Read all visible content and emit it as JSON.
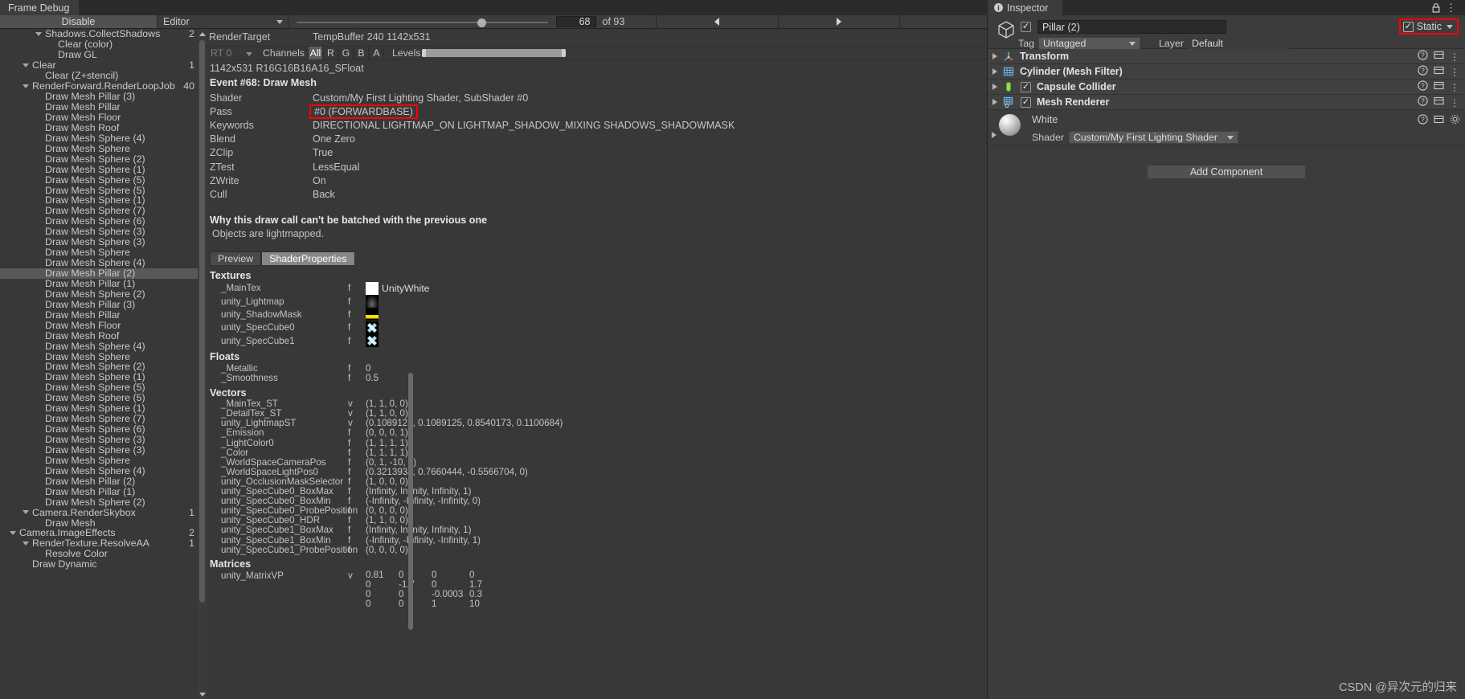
{
  "window": {
    "tab_title": "Frame Debug",
    "menu_icon": "⋮",
    "maximize_icon": "❐",
    "close_icon": "✕"
  },
  "toolbar": {
    "disable_label": "Disable",
    "context_value": "Editor",
    "event_index": "68",
    "event_total": "of 93",
    "prev_icon": "prev-triangle",
    "next_icon": "next-triangle"
  },
  "tree": {
    "items": [
      {
        "label": "Shadows.CollectShadows",
        "depth": 2,
        "arrow": true,
        "count": "2"
      },
      {
        "label": "Clear (color)",
        "depth": 3,
        "arrow": false,
        "count": ""
      },
      {
        "label": "Draw GL",
        "depth": 3,
        "arrow": false,
        "count": ""
      },
      {
        "label": "Clear",
        "depth": 1,
        "arrow": true,
        "count": "1"
      },
      {
        "label": "Clear (Z+stencil)",
        "depth": 2,
        "arrow": false,
        "count": ""
      },
      {
        "label": "RenderForward.RenderLoopJob",
        "depth": 1,
        "arrow": true,
        "count": "40"
      },
      {
        "label": "Draw Mesh Pillar (3)",
        "depth": 2,
        "arrow": false,
        "count": ""
      },
      {
        "label": "Draw Mesh Pillar",
        "depth": 2,
        "arrow": false,
        "count": ""
      },
      {
        "label": "Draw Mesh Floor",
        "depth": 2,
        "arrow": false,
        "count": ""
      },
      {
        "label": "Draw Mesh Roof",
        "depth": 2,
        "arrow": false,
        "count": ""
      },
      {
        "label": "Draw Mesh Sphere (4)",
        "depth": 2,
        "arrow": false,
        "count": ""
      },
      {
        "label": "Draw Mesh Sphere",
        "depth": 2,
        "arrow": false,
        "count": ""
      },
      {
        "label": "Draw Mesh Sphere (2)",
        "depth": 2,
        "arrow": false,
        "count": ""
      },
      {
        "label": "Draw Mesh Sphere (1)",
        "depth": 2,
        "arrow": false,
        "count": ""
      },
      {
        "label": "Draw Mesh Sphere (5)",
        "depth": 2,
        "arrow": false,
        "count": ""
      },
      {
        "label": "Draw Mesh Sphere (5)",
        "depth": 2,
        "arrow": false,
        "count": ""
      },
      {
        "label": "Draw Mesh Sphere (1)",
        "depth": 2,
        "arrow": false,
        "count": ""
      },
      {
        "label": "Draw Mesh Sphere (7)",
        "depth": 2,
        "arrow": false,
        "count": ""
      },
      {
        "label": "Draw Mesh Sphere (6)",
        "depth": 2,
        "arrow": false,
        "count": ""
      },
      {
        "label": "Draw Mesh Sphere (3)",
        "depth": 2,
        "arrow": false,
        "count": ""
      },
      {
        "label": "Draw Mesh Sphere (3)",
        "depth": 2,
        "arrow": false,
        "count": ""
      },
      {
        "label": "Draw Mesh Sphere",
        "depth": 2,
        "arrow": false,
        "count": ""
      },
      {
        "label": "Draw Mesh Sphere (4)",
        "depth": 2,
        "arrow": false,
        "count": ""
      },
      {
        "label": "Draw Mesh Pillar (2)",
        "depth": 2,
        "arrow": false,
        "count": "",
        "selected": true
      },
      {
        "label": "Draw Mesh Pillar (1)",
        "depth": 2,
        "arrow": false,
        "count": ""
      },
      {
        "label": "Draw Mesh Sphere (2)",
        "depth": 2,
        "arrow": false,
        "count": ""
      },
      {
        "label": "Draw Mesh Pillar (3)",
        "depth": 2,
        "arrow": false,
        "count": ""
      },
      {
        "label": "Draw Mesh Pillar",
        "depth": 2,
        "arrow": false,
        "count": ""
      },
      {
        "label": "Draw Mesh Floor",
        "depth": 2,
        "arrow": false,
        "count": ""
      },
      {
        "label": "Draw Mesh Roof",
        "depth": 2,
        "arrow": false,
        "count": ""
      },
      {
        "label": "Draw Mesh Sphere (4)",
        "depth": 2,
        "arrow": false,
        "count": ""
      },
      {
        "label": "Draw Mesh Sphere",
        "depth": 2,
        "arrow": false,
        "count": ""
      },
      {
        "label": "Draw Mesh Sphere (2)",
        "depth": 2,
        "arrow": false,
        "count": ""
      },
      {
        "label": "Draw Mesh Sphere (1)",
        "depth": 2,
        "arrow": false,
        "count": ""
      },
      {
        "label": "Draw Mesh Sphere (5)",
        "depth": 2,
        "arrow": false,
        "count": ""
      },
      {
        "label": "Draw Mesh Sphere (5)",
        "depth": 2,
        "arrow": false,
        "count": ""
      },
      {
        "label": "Draw Mesh Sphere (1)",
        "depth": 2,
        "arrow": false,
        "count": ""
      },
      {
        "label": "Draw Mesh Sphere (7)",
        "depth": 2,
        "arrow": false,
        "count": ""
      },
      {
        "label": "Draw Mesh Sphere (6)",
        "depth": 2,
        "arrow": false,
        "count": ""
      },
      {
        "label": "Draw Mesh Sphere (3)",
        "depth": 2,
        "arrow": false,
        "count": ""
      },
      {
        "label": "Draw Mesh Sphere (3)",
        "depth": 2,
        "arrow": false,
        "count": ""
      },
      {
        "label": "Draw Mesh Sphere",
        "depth": 2,
        "arrow": false,
        "count": ""
      },
      {
        "label": "Draw Mesh Sphere (4)",
        "depth": 2,
        "arrow": false,
        "count": ""
      },
      {
        "label": "Draw Mesh Pillar (2)",
        "depth": 2,
        "arrow": false,
        "count": ""
      },
      {
        "label": "Draw Mesh Pillar (1)",
        "depth": 2,
        "arrow": false,
        "count": ""
      },
      {
        "label": "Draw Mesh Sphere (2)",
        "depth": 2,
        "arrow": false,
        "count": ""
      },
      {
        "label": "Camera.RenderSkybox",
        "depth": 1,
        "arrow": true,
        "count": "1"
      },
      {
        "label": "Draw Mesh",
        "depth": 2,
        "arrow": false,
        "count": ""
      },
      {
        "label": "Camera.ImageEffects",
        "depth": 0,
        "arrow": true,
        "count": "2"
      },
      {
        "label": "RenderTexture.ResolveAA",
        "depth": 1,
        "arrow": true,
        "count": "1"
      },
      {
        "label": "Resolve Color",
        "depth": 2,
        "arrow": false,
        "count": ""
      },
      {
        "label": "Draw Dynamic",
        "depth": 1,
        "arrow": false,
        "count": ""
      }
    ]
  },
  "detail": {
    "render_target_label": "RenderTarget",
    "render_target_value": "TempBuffer 240 1142x531",
    "rt_selector": "RT 0",
    "channels_label": "Channels",
    "channels": [
      "All",
      "R",
      "G",
      "B",
      "A"
    ],
    "channels_active": "All",
    "levels_label": "Levels",
    "format": "1142x531 R16G16B16A16_SFloat",
    "event_title": "Event #68: Draw Mesh",
    "props": [
      {
        "key": "Shader",
        "value": "Custom/My First Lighting Shader, SubShader #0",
        "highlight": false
      },
      {
        "key": "Pass",
        "value": "#0 (FORWARDBASE)",
        "highlight": true
      },
      {
        "key": "Keywords",
        "value": "DIRECTIONAL LIGHTMAP_ON LIGHTMAP_SHADOW_MIXING SHADOWS_SHADOWMASK",
        "highlight": false
      },
      {
        "key": "Blend",
        "value": "One Zero",
        "highlight": false
      },
      {
        "key": "ZClip",
        "value": "True",
        "highlight": false
      },
      {
        "key": "ZTest",
        "value": "LessEqual",
        "highlight": false
      },
      {
        "key": "ZWrite",
        "value": "On",
        "highlight": false
      },
      {
        "key": "Cull",
        "value": "Back",
        "highlight": false
      }
    ],
    "batch_title": "Why this draw call can't be batched with the previous one",
    "batch_reason": "Objects are lightmapped.",
    "tabs": [
      {
        "label": "Preview",
        "active": false
      },
      {
        "label": "ShaderProperties",
        "active": true
      }
    ],
    "textures_header": "Textures",
    "textures": [
      {
        "name": "_MainTex",
        "type": "f",
        "swatch": "white",
        "texname": "UnityWhite"
      },
      {
        "name": "unity_Lightmap",
        "type": "f",
        "swatch": "lightmap",
        "texname": ""
      },
      {
        "name": "unity_ShadowMask",
        "type": "f",
        "swatch": "shadowmask",
        "texname": ""
      },
      {
        "name": "unity_SpecCube0",
        "type": "f",
        "swatch": "speccube",
        "texname": ""
      },
      {
        "name": "unity_SpecCube1",
        "type": "f",
        "swatch": "speccube",
        "texname": ""
      }
    ],
    "floats_header": "Floats",
    "floats": [
      {
        "name": "_Metallic",
        "type": "f",
        "value": "0"
      },
      {
        "name": "_Smoothness",
        "type": "f",
        "value": "0.5"
      }
    ],
    "vectors_header": "Vectors",
    "vectors": [
      {
        "name": "_MainTex_ST",
        "type": "v",
        "value": "(1, 1, 0, 0)"
      },
      {
        "name": "_DetailTex_ST",
        "type": "v",
        "value": "(1, 1, 0, 0)"
      },
      {
        "name": "unity_LightmapST",
        "type": "v",
        "value": "(0.1089125, 0.1089125, 0.8540173, 0.1100684)"
      },
      {
        "name": "_Emission",
        "type": "f",
        "value": "(0, 0, 0, 1)"
      },
      {
        "name": "_LightColor0",
        "type": "f",
        "value": "(1, 1, 1, 1)"
      },
      {
        "name": "_Color",
        "type": "f",
        "value": "(1, 1, 1, 1)"
      },
      {
        "name": "_WorldSpaceCameraPos",
        "type": "f",
        "value": "(0, 1, -10, 0)"
      },
      {
        "name": "_WorldSpaceLightPos0",
        "type": "f",
        "value": "(0.3213938, 0.7660444, -0.5566704, 0)"
      },
      {
        "name": "unity_OcclusionMaskSelector",
        "type": "f",
        "value": "(1, 0, 0, 0)"
      },
      {
        "name": "unity_SpecCube0_BoxMax",
        "type": "f",
        "value": "(Infinity, Infinity, Infinity, 1)"
      },
      {
        "name": "unity_SpecCube0_BoxMin",
        "type": "f",
        "value": "(-Infinity, -Infinity, -Infinity, 0)"
      },
      {
        "name": "unity_SpecCube0_ProbePosition",
        "type": "f",
        "value": "(0, 0, 0, 0)"
      },
      {
        "name": "unity_SpecCube0_HDR",
        "type": "f",
        "value": "(1, 1, 0, 0)"
      },
      {
        "name": "unity_SpecCube1_BoxMax",
        "type": "f",
        "value": "(Infinity, Infinity, Infinity, 1)"
      },
      {
        "name": "unity_SpecCube1_BoxMin",
        "type": "f",
        "value": "(-Infinity, -Infinity, -Infinity, 1)"
      },
      {
        "name": "unity_SpecCube1_ProbePosition",
        "type": "f",
        "value": "(0, 0, 0, 0)"
      }
    ],
    "matrices_header": "Matrices",
    "matrices": [
      {
        "name": "unity_MatrixVP",
        "type": "v",
        "rows": [
          [
            "0.81",
            "0",
            "0",
            "0"
          ],
          [
            "0",
            "-1.7",
            "0",
            "1.7"
          ],
          [
            "0",
            "0",
            "-0.0003",
            "0.3"
          ],
          [
            "0",
            "0",
            "1",
            "10"
          ]
        ]
      }
    ]
  },
  "inspector": {
    "tab_label": "Inspector",
    "info_icon": "i",
    "lock_icon": "lock-icon",
    "menu_icon": "⋮",
    "object_name": "Pillar (2)",
    "object_enabled": "✓",
    "static_label": "Static",
    "static_checked": "✓",
    "tag_label": "Tag",
    "tag_value": "Untagged",
    "layer_label": "Layer",
    "layer_value": "Default",
    "components": [
      {
        "name": "Transform",
        "icon": "transform-icon",
        "has_toggle": false,
        "checked": ""
      },
      {
        "name": "Cylinder (Mesh Filter)",
        "icon": "mesh-filter-icon",
        "has_toggle": false,
        "checked": ""
      },
      {
        "name": "Capsule Collider",
        "icon": "capsule-collider-icon",
        "has_toggle": true,
        "checked": "✓"
      },
      {
        "name": "Mesh Renderer",
        "icon": "mesh-renderer-icon",
        "has_toggle": true,
        "checked": "✓"
      }
    ],
    "material_name": "White",
    "shader_label": "Shader",
    "shader_value": "Custom/My First Lighting Shader",
    "add_component_label": "Add Component"
  },
  "watermark": "CSDN @异次元的归来",
  "colors": {
    "accent_red": "#ff0000",
    "panel_bg": "#383838",
    "toolbar_bg": "#3c3c3c",
    "selection": "#585858"
  }
}
